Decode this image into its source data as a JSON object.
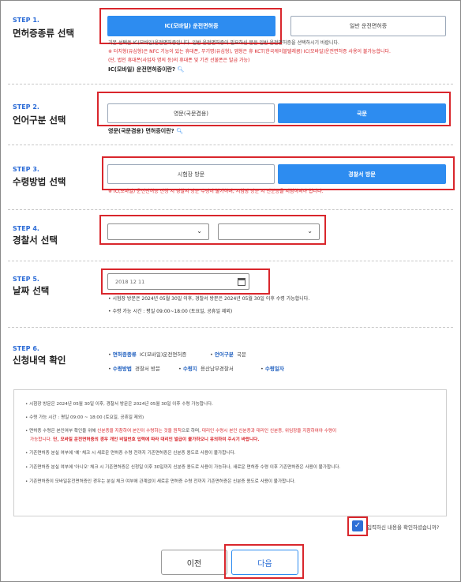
{
  "step1": {
    "label": "STEP 1.",
    "title": "면허증종류 선택",
    "options": [
      "IC(모바일) 운전면허증",
      "일반 운전면허증"
    ],
    "note1": "기본 선택은 IC(모바일)운전면허증입니다. 일반 운전면허증이 필요하신 분은 일반 운전면허증을 선택하시기 바랍니다.",
    "note2": "※ 터치형(유심형)은 NFC 기능이 있는 휴대폰, 무기명(유심형), 앱형은 휴 KCT(한국케이블텔레콤) IC(모바일)운전면허증 사용이 불가능합니다.",
    "note3": "(단, 법인 휴대폰(사업자 명의 등)의 휴대폰 및 기관 선불폰은 발급 가능)",
    "link": "IC(모바일) 운전면허증이란?"
  },
  "step2": {
    "label": "STEP 2.",
    "title": "언어구분 선택",
    "options": [
      "영문(국문겸용)",
      "국문"
    ],
    "link": "영문(국문겸용) 면허증이란?"
  },
  "step3": {
    "label": "STEP 3.",
    "title": "수령방법 선택",
    "options": [
      "시험장 방문",
      "경찰서 방문"
    ],
    "note": "※ IC(모바일) 운전면허증 신청 시 경찰서 방문 수령이 불가하며, 시험장 방문 시 신분증을 지참하셔야 합니다."
  },
  "step4": {
    "label": "STEP 4.",
    "title": "경찰서 선택"
  },
  "step5": {
    "label": "STEP 5.",
    "title": "날짜 선택",
    "date": "2018 12 11",
    "bullet1": "시험장 방문은 2024년 05월 30일 이후, 경찰서 방문은 2024년 05월 30일 이후 수령 가능합니다.",
    "bullet2": "수령 가능 시간 : 평일 09:00~18:00 (토요일, 공휴일 제외)"
  },
  "step6": {
    "label": "STEP 6.",
    "title": "신청내역 확인",
    "license_type_key": "면허증종류",
    "license_type_val": "IC(모바일)운전면허증",
    "language_key": "언어구분",
    "language_val": "국문",
    "method_key": "수령방법",
    "method_val": "경찰서 방문",
    "place_key": "수령지",
    "place_val": "용산남부경찰서",
    "date_key": "수령일자",
    "date_val": ""
  },
  "notice": {
    "line1": "시험장 방문은 2024년 05월 30일 이후, 경찰서 방문은 2024년 05월 30일 이후 수령 가능합니다.",
    "line2": "수령 가능 시간 : 평일 09:00 ~ 18:00 (토요일, 공휴일 제외)",
    "line3a": "면허증 수령은 본인여부 확인을 위해 ",
    "line3b": "신분증을 지참하여 본인이 수령하는 것을 원칙",
    "line3c": "으로 하며, ",
    "line3d": "대리인 수령시 본인 신분증과 대리인 신분증, 위임장을 지참하여야 수령이",
    "line4a": "가능합니다. ",
    "line4b": "단, 모바일 운전면허증의 경우 개인 비밀번호 입력에 따라 대리인 발급이 불가하오니 유의하여 주시기 바랍니다.",
    "line5": "기존면허증 분실 여부에 '예' 체크 시 새로운 면허증 수령 전까지 기존면허증은 신분증 용도로 사용이 불가합니다.",
    "line6": "기존면허증 분실 여부에 '아니오' 체크 시 기존면허증은 신청일 이후 30일까지 신분증 용도로 사용이 가능하나, 새로운 면허증 수령 이후 기존면허증은 사용이 불가합니다.",
    "line7": "기존면허증이 모바일운전면허증인 경우는 분실 체크 여부에 관계없이 새로운 면허증 수령 전까지 기존면허증은 신분증 용도로 사용이 불가합니다."
  },
  "confirm": {
    "label": "입력하신 내용을 확인하셨습니까?",
    "checked": true
  },
  "buttons": {
    "prev": "이전",
    "next": "다음"
  },
  "colors": {
    "accent": "#2d8cf0",
    "highlight_box": "#d9262c",
    "step_label": "#2b6bd6"
  }
}
